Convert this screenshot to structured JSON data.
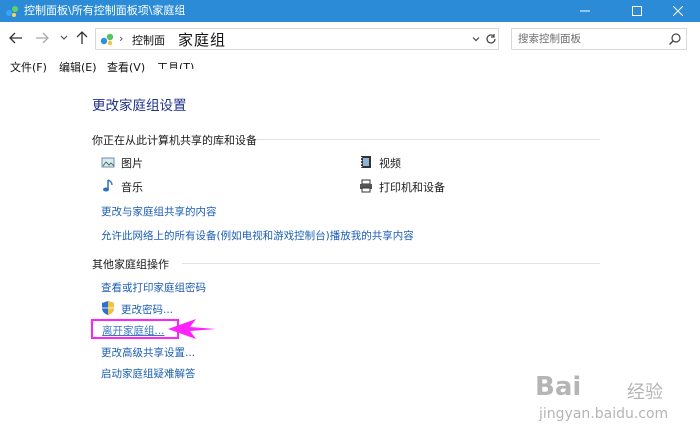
{
  "window": {
    "title": "控制面板\\所有控制面板项\\家庭组",
    "titlebar_color": "#2b8bd6"
  },
  "address": {
    "separator": "›",
    "crumb1": "控制面",
    "crumb2": "家庭组",
    "search_placeholder": "搜索控制面板"
  },
  "menu": {
    "file": "文件(F)",
    "edit": "编辑(E)",
    "view": "查看(V)",
    "tools": "工具(T)"
  },
  "page": {
    "title": "更改家庭组设置",
    "shared_section": {
      "heading": "你正在从此计算机共享的库和设备",
      "items": [
        {
          "icon": "pictures-icon",
          "label": "图片"
        },
        {
          "icon": "videos-icon",
          "label": "视频"
        },
        {
          "icon": "music-icon",
          "label": "音乐"
        },
        {
          "icon": "printer-icon",
          "label": "打印机和设备"
        }
      ],
      "change_share_link": "更改与家庭组共享的内容",
      "allow_devices_link": "允许此网络上的所有设备(例如电视和游戏控制台)播放我的共享内容"
    },
    "other_section": {
      "heading": "其他家庭组操作",
      "view_print_password": "查看或打印家庭组密码",
      "change_password": "更改密码...",
      "leave_homegroup": "离开家庭组...",
      "advanced_sharing": "更改高级共享设置...",
      "troubleshooter": "启动家庭组疑难解答"
    },
    "highlight_color": "#ff22ff",
    "link_color": "#1c5fb3"
  },
  "watermark": {
    "brand": "Bai",
    "brand2": "经验",
    "url": "jingyan.baidu.com"
  }
}
